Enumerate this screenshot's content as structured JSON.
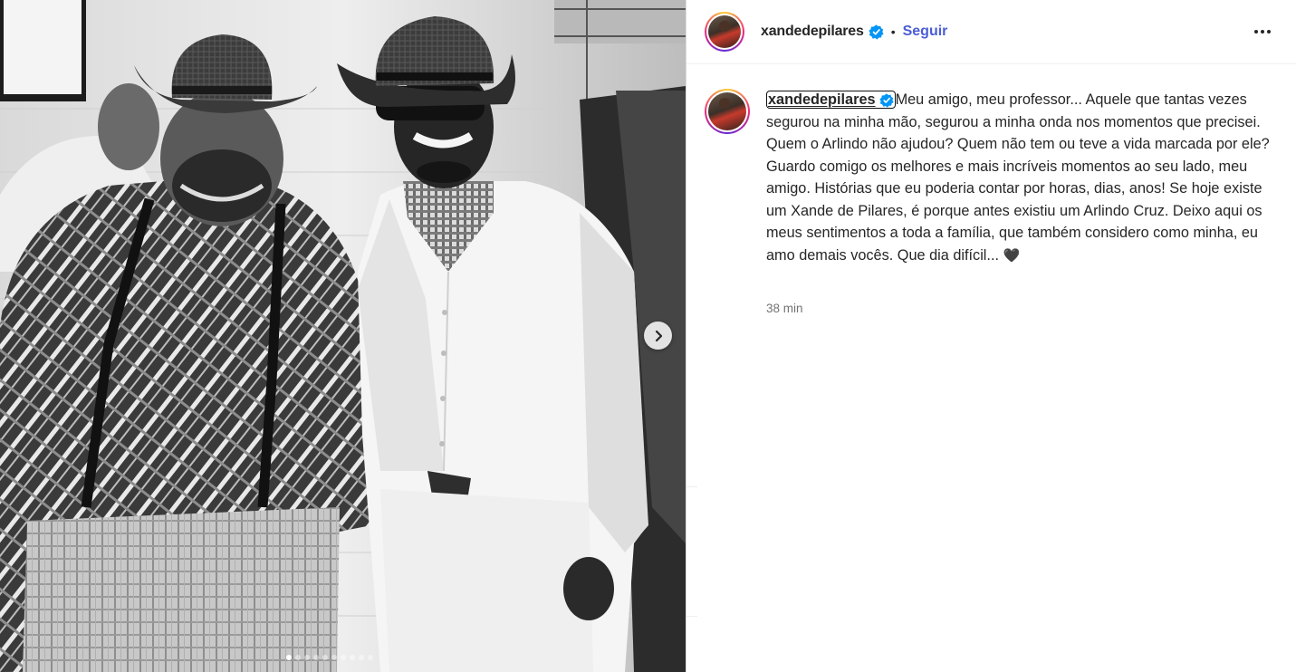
{
  "post_header": {
    "username": "xandedepilares",
    "separator": "•",
    "follow_label": "Seguir"
  },
  "caption": {
    "username": "xandedepilares",
    "text": "Meu amigo, meu professor... Aquele que tantas vezes segurou na minha mão, segurou a minha onda nos momentos que precisei. Quem o Arlindo não ajudou? Quem não tem ou teve a vida marcada por ele? Guardo comigo os melhores e mais incríveis momentos ao seu lado, meu amigo. Histórias que eu poderia contar por horas, dias, anos! Se hoje existe um Xande de Pilares, é porque antes existiu um Arlindo Cruz. Deixo aqui os meus sentimentos a toda a família, que também considero como minha, eu amo demais vocês. Que dia difícil...",
    "emoji": "🖤",
    "timestamp": "38 min"
  },
  "carousel": {
    "total_slides": 10,
    "active_index": 0
  },
  "colors": {
    "follow": "#4a5dd8",
    "verified": "#0095f6",
    "timestamp": "#737373"
  },
  "icons": {
    "verified": "verified-badge-icon",
    "more": "more-options-icon",
    "next": "chevron-right-icon"
  }
}
